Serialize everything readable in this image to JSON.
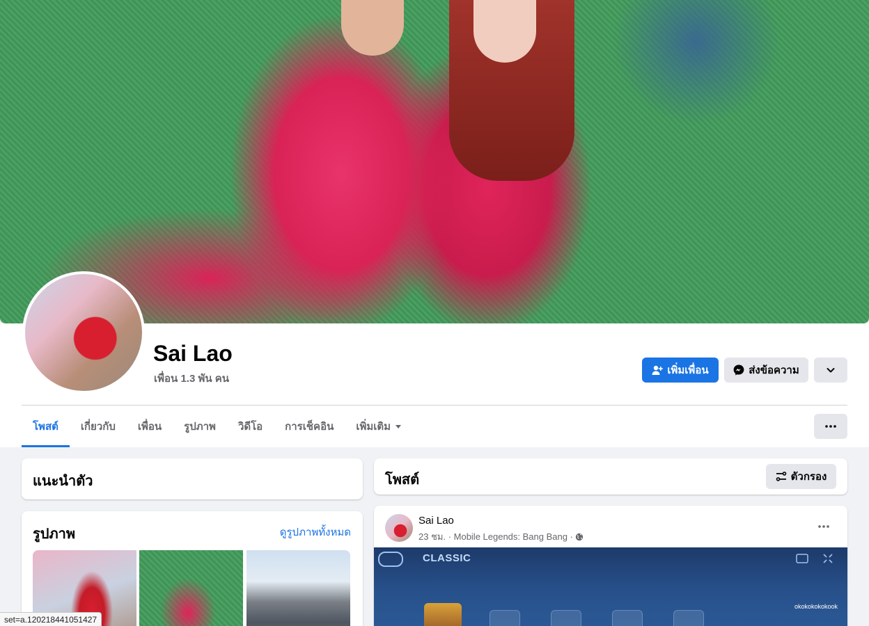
{
  "profile": {
    "name": "Sai Lao",
    "friends": "เพื่อน 1.3 พัน คน"
  },
  "actions": {
    "add_friend": "เพิ่มเพื่อน",
    "message": "ส่งข้อความ"
  },
  "tabs": [
    {
      "label": "โพสต์",
      "active": true
    },
    {
      "label": "เกี่ยวกับ"
    },
    {
      "label": "เพื่อน"
    },
    {
      "label": "รูปภาพ"
    },
    {
      "label": "วิดีโอ"
    },
    {
      "label": "การเช็คอิน"
    },
    {
      "label": "เพิ่มเติม"
    }
  ],
  "intro": {
    "title": "แนะนำตัว"
  },
  "photos": {
    "title": "รูปภาพ",
    "see_all": "ดูรูปภาพทั้งหมด"
  },
  "posts": {
    "title": "โพสต์",
    "filter": "ตัวกรอง"
  },
  "post": {
    "author": "Sai Lao",
    "meta": "23 ชม. · Mobile Legends: Bang Bang ·",
    "game_mode": "CLASSIC",
    "player": "okokokokokook"
  },
  "status_url": "set=a.120218441051427",
  "colors": {
    "accent": "#1b74e4",
    "secondary_btn": "#e4e6eb",
    "muted_text": "#65676b"
  }
}
